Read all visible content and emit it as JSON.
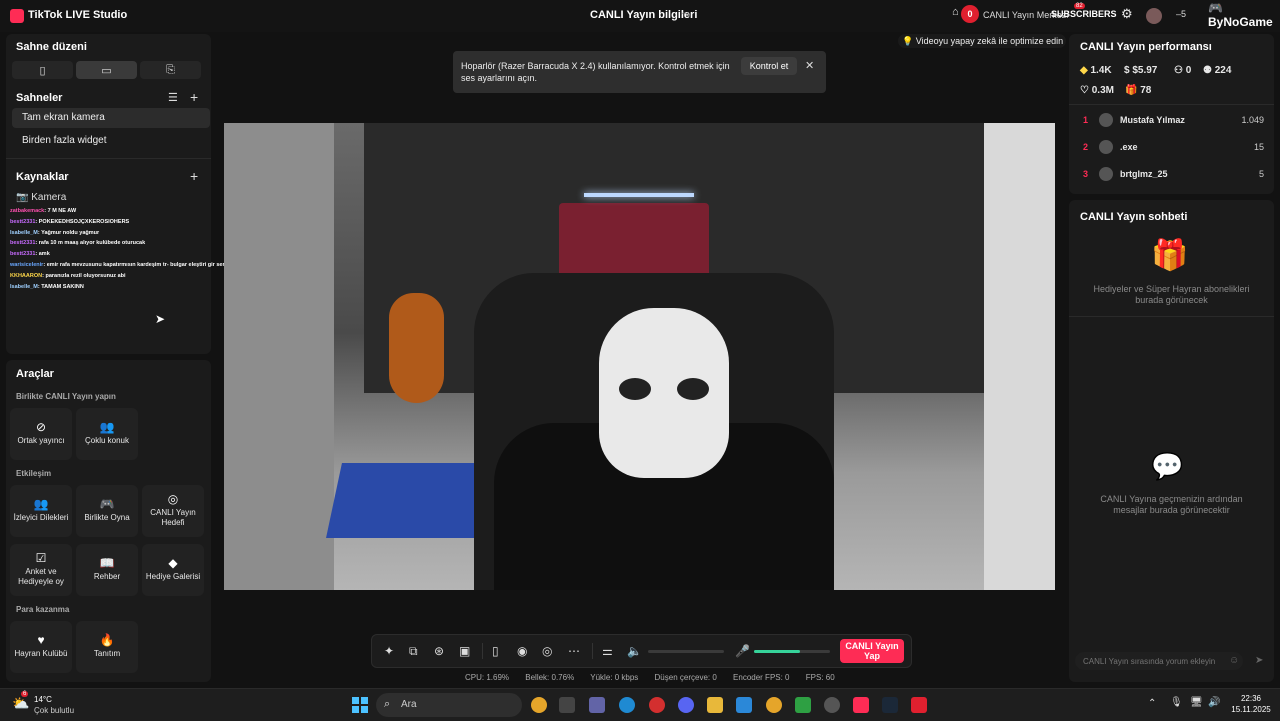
{
  "app": {
    "title": "TikTok LIVE Studio",
    "center_title": "CANLI Yayın bilgileri"
  },
  "topright": {
    "badge": "0",
    "live_center": "CANLI Yayın Merkezi",
    "badge2": "82",
    "subscribers": "SUBSCRIBERS",
    "counter": "5",
    "brand": "ByNoGame"
  },
  "left": {
    "scene_layout_title": "Sahne düzeni",
    "scenes_title": "Sahneler",
    "scenes": [
      "Tam ekran kamera",
      "Birden fazla widget"
    ],
    "sources_title": "Kaynaklar",
    "source_camera": "Kamera",
    "chat": [
      {
        "user": "zatbakemack",
        "text": ": 7 M NE AW",
        "color": "#ff4fb0"
      },
      {
        "user": "bestt2331",
        "text": ": POKEKEDHSOJÇXKEROSIOHERS",
        "color": "#c86bff"
      },
      {
        "user": "Isabelle_M",
        "text": ": Yağmur noldu yağmur",
        "color": "#9fd0ff"
      },
      {
        "user": "bestt2331",
        "text": ": rafa 10 m maaş alıyor kulübede oturucak",
        "color": "#c86bff"
      },
      {
        "user": "bestt2331",
        "text": ": amk",
        "color": "#c86bff"
      },
      {
        "user": "warisicelenir",
        "text": ": emir rafa mevzusunu kapatırmısın kardeşim tr- bulgar eleştiri gir seri",
        "color": "#6aa8ff"
      },
      {
        "user": "KKHAARON",
        "text": ": paranızla rezil oluyorsunuz abi",
        "color": "#ffd84a"
      },
      {
        "user": "Isabelle_M",
        "text": ": TAMAM SAKINN",
        "color": "#9fd0ff"
      }
    ]
  },
  "tools": {
    "title": "Araçlar",
    "group1": "Birlikte CANLI Yayın yapın",
    "cohost": "Ortak yayıncı",
    "multi_guest": "Çoklu konuk",
    "group2": "Etkileşim",
    "viewer_requests": "İzleyici Dilekleri",
    "play_together": "Birlikte Oyna",
    "live_goal": "CANLI Yayın Hedefi",
    "poll": "Anket ve Hediyeyle oy",
    "guide": "Rehber",
    "gift_gallery": "Hediye Galerisi",
    "group3": "Para kazanma",
    "fan_club": "Hayran Kulübü",
    "promote": "Tanıtım"
  },
  "notification": {
    "message": "Hoparlör (Razer Barracuda X 2.4) kullanılamıyor. Kontrol etmek için ses ayarlarını açın.",
    "button": "Kontrol et",
    "close": "✕"
  },
  "ai_optimize": "Videoyu yapay zekâ ile optimize edin",
  "golive": "CANLI Yayın Yap",
  "volume": {
    "speaker_level": 0,
    "mic_level": 0.6
  },
  "stats": {
    "cpu": "CPU:  1.69%",
    "memory": "Bellek:  0.76%",
    "upload": "Yükle:  0 kbps",
    "dropped": "Düşen çerçeve:  0",
    "encoder": "Encoder FPS:  0",
    "fps": "FPS:  60"
  },
  "performance": {
    "title": "CANLI Yayın performansı",
    "diamonds": "1.4K",
    "earnings": "$5.97",
    "viewers": "0",
    "followers": "224",
    "likes": "0.3M",
    "gifts": "78",
    "ranking": [
      {
        "rank": "1",
        "name": "Mustafa Yılmaz",
        "score": "1.049"
      },
      {
        "rank": "2",
        "name": ".exe",
        "score": "15"
      },
      {
        "rank": "3",
        "name": "brtglmz_25",
        "score": "5"
      }
    ]
  },
  "chat_panel": {
    "title": "CANLI Yayın sohbeti",
    "gifts_empty": "Hediyeler ve Süper Hayran abonelikleri burada görünecek",
    "messages_empty": "CANLI Yayına geçmenizin ardından mesajlar burada görünecektir",
    "input_placeholder": "CANLI Yayın sırasında yorum ekleyin"
  },
  "taskbar": {
    "temp": "14°C",
    "weather": "Çok bulutlu",
    "weather_badge": "6",
    "search": "Ara",
    "time": "22:36",
    "date": "15.11.2025"
  }
}
